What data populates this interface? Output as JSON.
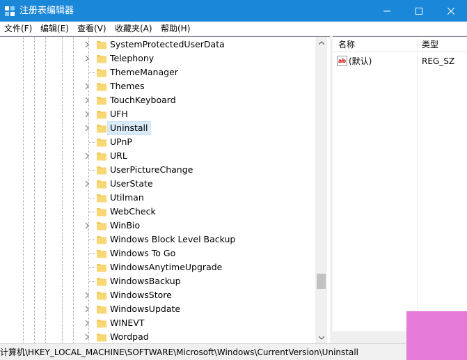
{
  "window": {
    "title": "注册表编辑器",
    "controls": {
      "minimize": "minimize-icon",
      "maximize": "maximize-icon",
      "close": "close-icon"
    }
  },
  "menu": [
    "文件(F)",
    "编辑(E)",
    "查看(V)",
    "收藏夹(A)",
    "帮助(H)"
  ],
  "tree": {
    "nodes": [
      {
        "label": "SystemProtectedUserData",
        "expandable": true
      },
      {
        "label": "Telephony",
        "expandable": true
      },
      {
        "label": "ThemeManager",
        "expandable": false
      },
      {
        "label": "Themes",
        "expandable": true
      },
      {
        "label": "TouchKeyboard",
        "expandable": true
      },
      {
        "label": "UFH",
        "expandable": true
      },
      {
        "label": "Uninstall",
        "expandable": true,
        "selected": true
      },
      {
        "label": "UPnP",
        "expandable": false
      },
      {
        "label": "URL",
        "expandable": true
      },
      {
        "label": "UserPictureChange",
        "expandable": false
      },
      {
        "label": "UserState",
        "expandable": true
      },
      {
        "label": "Utilman",
        "expandable": false
      },
      {
        "label": "WebCheck",
        "expandable": false
      },
      {
        "label": "WinBio",
        "expandable": true
      },
      {
        "label": "Windows Block Level Backup",
        "expandable": false
      },
      {
        "label": "Windows To Go",
        "expandable": false
      },
      {
        "label": "WindowsAnytimeUpgrade",
        "expandable": false
      },
      {
        "label": "WindowsBackup",
        "expandable": false
      },
      {
        "label": "WindowsStore",
        "expandable": true
      },
      {
        "label": "WindowsUpdate",
        "expandable": true
      },
      {
        "label": "WINEVT",
        "expandable": true
      },
      {
        "label": "Wordpad",
        "expandable": true
      }
    ]
  },
  "list": {
    "headers": {
      "name": "名称",
      "type": "类型"
    },
    "rows": [
      {
        "name": "(默认)",
        "type": "REG_SZ",
        "icon": "string-value-icon"
      }
    ]
  },
  "status": {
    "path": "计算机\\HKEY_LOCAL_MACHINE\\SOFTWARE\\Microsoft\\Windows\\CurrentVersion\\Uninstall"
  },
  "colors": {
    "titlebar": "#1b87d8",
    "selection": "#d9ebf9",
    "folder": "#f4c95a",
    "watermark": "#e57ad9"
  }
}
